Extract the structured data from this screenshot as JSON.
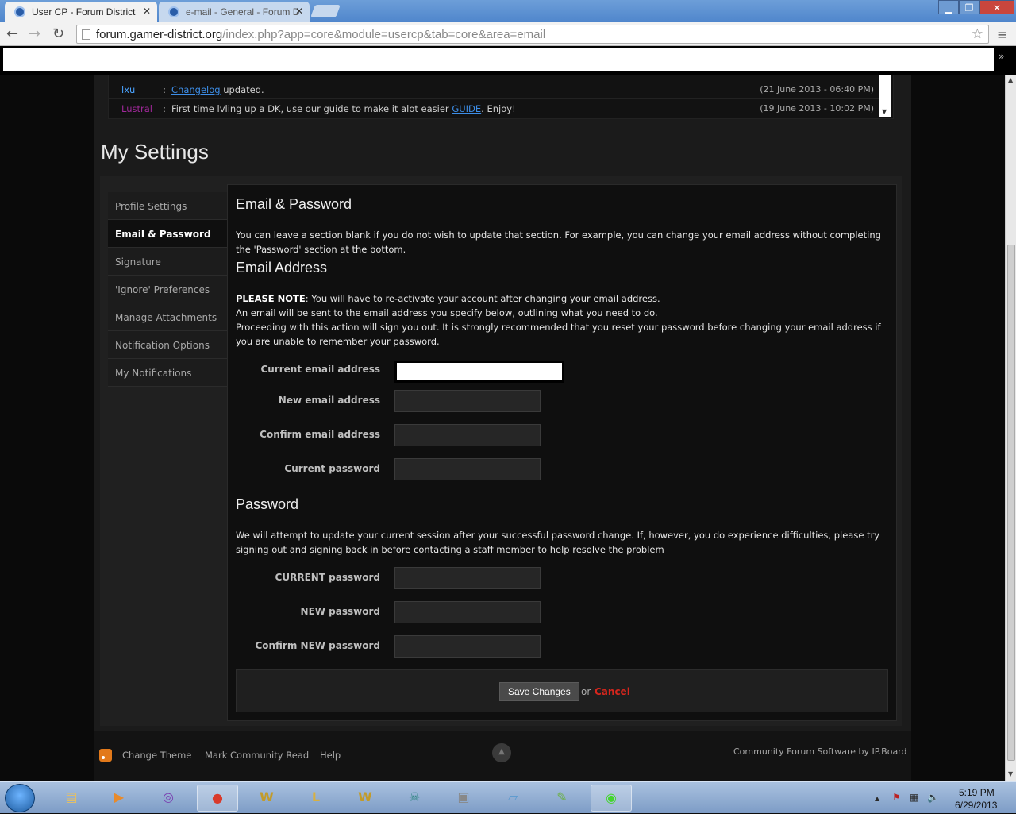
{
  "browser": {
    "tabs": [
      {
        "label": "User CP - Forum District",
        "active": true
      },
      {
        "label": "e-mail - General - Forum D",
        "active": false
      }
    ],
    "url_domain": "forum.gamer-district.org",
    "url_path": "/index.php?app=core&module=usercp&tab=core&area=email",
    "window_controls": {
      "minimize": "▁",
      "maximize": "❐",
      "close": "✕"
    },
    "more_bookmarks": "»"
  },
  "shoutbox": {
    "rows": [
      {
        "user": "lxu",
        "user_color": "#4aa3ff",
        "link": "Changelog",
        "text_after": "updated.",
        "time": "(21 June 2013 - 06:40 PM)"
      },
      {
        "user": "Lustral",
        "user_color": "#a0289a",
        "text_before": "First time lvling up a DK, use our guide to make it alot easier",
        "link": "GUIDE",
        "text_after": ". Enjoy!",
        "time": "(19 June 2013 - 10:02 PM)"
      }
    ]
  },
  "page": {
    "title": "My Settings"
  },
  "sidebar": {
    "items": [
      {
        "label": "Profile Settings",
        "active": false
      },
      {
        "label": "Email & Password",
        "active": true
      },
      {
        "label": "Signature",
        "active": false
      },
      {
        "label": "'Ignore' Preferences",
        "active": false
      },
      {
        "label": "Manage Attachments",
        "active": false
      },
      {
        "label": "Notification Options",
        "active": false
      },
      {
        "label": "My Notifications",
        "active": false
      }
    ]
  },
  "content": {
    "heading": "Email & Password",
    "intro": "You can leave a section blank if you do not wish to update that section. For example, you can change your email address without completing the 'Password' section at the bottom.",
    "email_heading": "Email Address",
    "note_label": "PLEASE NOTE",
    "note_line1": ": You will have to re-activate your account after changing your email address.",
    "note_line2": "An email will be sent to the email address you specify below, outlining what you need to do.",
    "note_line3": "Proceeding with this action will sign you out. It is strongly recommended that you reset your password before changing your email address if you are unable to remember your password.",
    "email_fields": [
      {
        "label": "Current email address",
        "value": ""
      },
      {
        "label": "New email address",
        "value": ""
      },
      {
        "label": "Confirm email address",
        "value": ""
      },
      {
        "label": "Current password",
        "value": ""
      }
    ],
    "password_heading": "Password",
    "password_intro": "We will attempt to update your current session after your successful password change. If, however, you do experience difficulties, please try signing out and signing back in before contacting a staff member to help resolve the problem",
    "password_fields": [
      {
        "label": "CURRENT password",
        "value": ""
      },
      {
        "label": "NEW password",
        "value": ""
      },
      {
        "label": "Confirm NEW password",
        "value": ""
      }
    ],
    "save_label": "Save Changes",
    "or_label": "or",
    "cancel_label": "Cancel"
  },
  "footer": {
    "links": [
      "Change Theme",
      "Mark Community Read",
      "Help"
    ],
    "powered_by": "Community Forum Software by IP.Board",
    "to_top": "▲"
  },
  "taskbar": {
    "apps": [
      {
        "name": "explorer-icon",
        "glyph": "▤",
        "color": "#e8c060"
      },
      {
        "name": "media-player-icon",
        "glyph": "▶",
        "color": "#e88a2a"
      },
      {
        "name": "app-swirl-icon",
        "glyph": "◎",
        "color": "#7a3fb0"
      },
      {
        "name": "chrome-icon",
        "glyph": "●",
        "color": "#d93a2b"
      },
      {
        "name": "wow-icon",
        "glyph": "W",
        "color": "#c29b2a"
      },
      {
        "name": "lol-icon",
        "glyph": "L",
        "color": "#d8b040"
      },
      {
        "name": "wow-icon-2",
        "glyph": "W",
        "color": "#c29b2a"
      },
      {
        "name": "skull-icon",
        "glyph": "☠",
        "color": "#3a8a8a"
      },
      {
        "name": "truck-icon",
        "glyph": "▣",
        "color": "#888"
      },
      {
        "name": "tablet-icon",
        "glyph": "▱",
        "color": "#5a9ad0"
      },
      {
        "name": "notepad-icon",
        "glyph": "✎",
        "color": "#6ab040"
      },
      {
        "name": "razer-icon",
        "glyph": "◉",
        "color": "#44d62c"
      }
    ],
    "tray": [
      "▲",
      "⚑",
      "▦",
      "🔈"
    ],
    "time": "5:19 PM",
    "date": "6/29/2013"
  }
}
